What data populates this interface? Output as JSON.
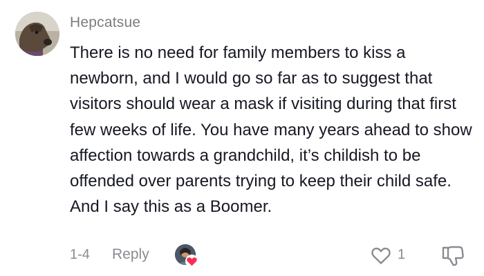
{
  "comment": {
    "username": "Hepcatsue",
    "text": "There is no need for family members to kiss a newborn, and I would go so far as to suggest that visitors should wear a mask if visiting during that first few weeks of life. You have many years ahead to show affection towards a grandchild, it’s childish to be offended over parents trying to keep their child safe. And I say this as a Boomer.",
    "date": "1-4",
    "reply_label": "Reply",
    "like_count": "1",
    "creator_liked": true
  },
  "icons": {
    "avatar": "dog-avatar",
    "creator": "creator-avatar",
    "liked": "heart-icon",
    "like": "heart-outline-icon",
    "dislike": "thumbs-down-icon"
  },
  "colors": {
    "text": "#161823",
    "muted": "#8a8b91",
    "username": "#7c7c7c",
    "heart": "#fe2c55"
  }
}
